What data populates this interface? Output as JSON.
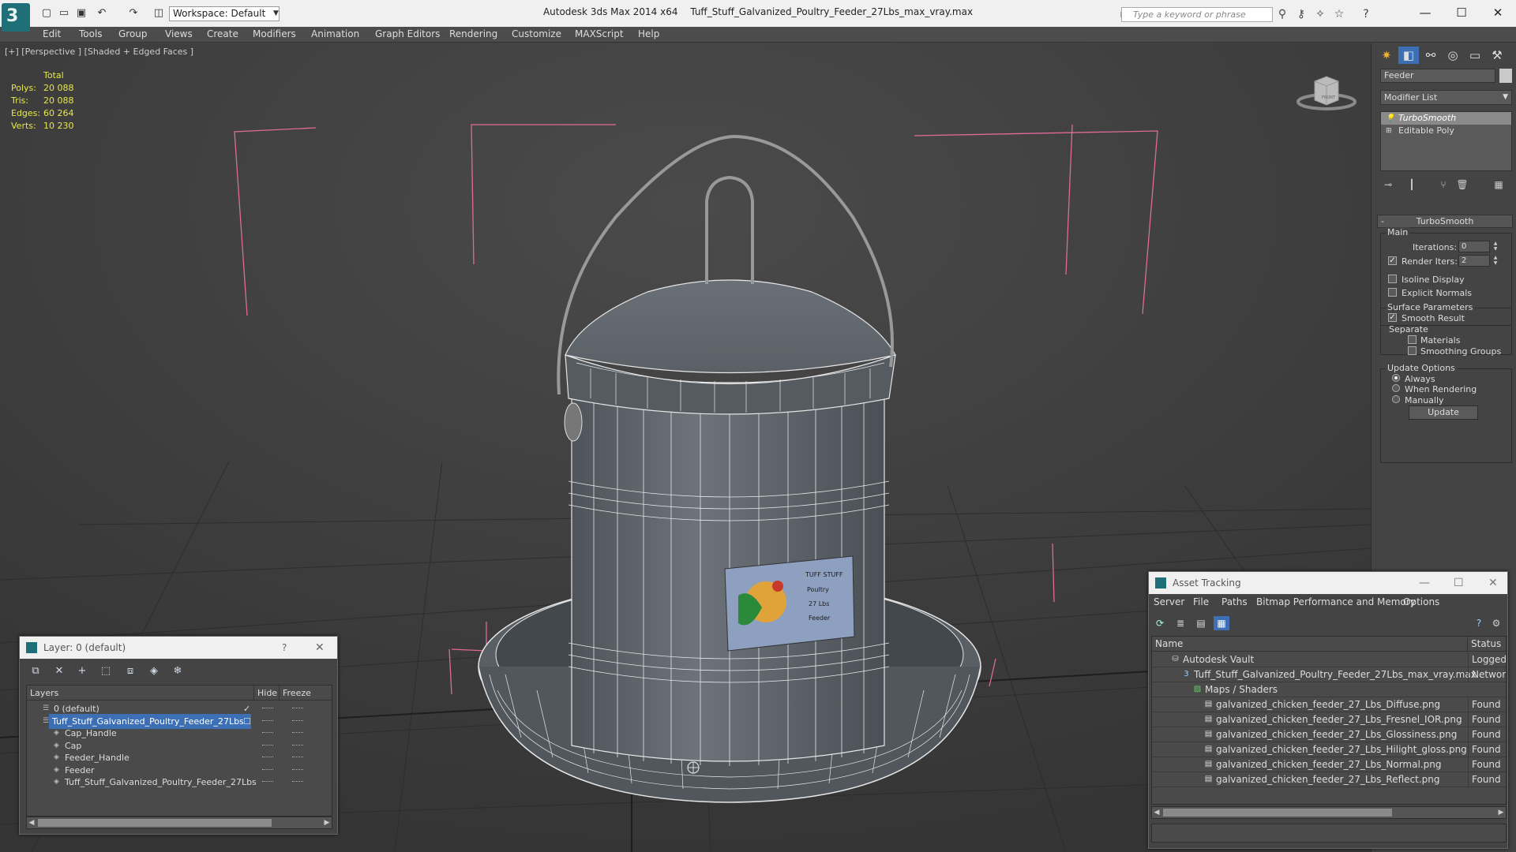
{
  "titlebar": {
    "workspace": "Workspace: Default",
    "app_name": "Autodesk 3ds Max  2014 x64",
    "file_name": "Tuff_Stuff_Galvanized_Poultry_Feeder_27Lbs_max_vray.max",
    "search_placeholder": "Type a keyword or phrase"
  },
  "menu": [
    "Edit",
    "Tools",
    "Group",
    "Views",
    "Create",
    "Modifiers",
    "Animation",
    "Graph Editors",
    "Rendering",
    "Customize",
    "MAXScript",
    "Help"
  ],
  "viewport": {
    "label": "[+] [Perspective ] [Shaded + Edged Faces ]",
    "stats": {
      "header": "Total",
      "rows": [
        {
          "label": "Polys:",
          "value": "20 088"
        },
        {
          "label": "Tris:",
          "value": "20 088"
        },
        {
          "label": "Edges:",
          "value": "60 264"
        },
        {
          "label": "Verts:",
          "value": "10 230"
        }
      ]
    },
    "viewcube_label": "FRONT",
    "feeder_label_text": [
      "TUFF STUFF",
      "Poultry",
      "27 Lbs",
      "Feeder"
    ]
  },
  "command_panel": {
    "object_name": "Feeder",
    "modifier_list": "Modifier List",
    "stack": [
      "TurboSmooth",
      "Editable Poly"
    ],
    "rollout_title": "TurboSmooth",
    "main": {
      "title": "Main",
      "iterations_label": "Iterations:",
      "iterations_value": "0",
      "render_iters_label": "Render Iters:",
      "render_iters_value": "2",
      "isoline_label": "Isoline Display",
      "explicit_label": "Explicit Normals"
    },
    "surface": {
      "title": "Surface Parameters",
      "smooth_label": "Smooth Result",
      "separate_label": "Separate",
      "materials_label": "Materials",
      "smoothing_groups_label": "Smoothing Groups"
    },
    "update": {
      "title": "Update Options",
      "always": "Always",
      "when_rendering": "When Rendering",
      "manually": "Manually",
      "update_button": "Update"
    }
  },
  "layer_dialog": {
    "title": "Layer: 0 (default)",
    "help": "?",
    "headers": {
      "layers": "Layers",
      "hide": "Hide",
      "freeze": "Freeze"
    },
    "rows": [
      {
        "name": "0 (default)",
        "level": 1
      },
      {
        "name": "Tuff_Stuff_Galvanized_Poultry_Feeder_27Lbs",
        "level": 1
      },
      {
        "name": "Cap_Handle",
        "level": 2
      },
      {
        "name": "Cap",
        "level": 2
      },
      {
        "name": "Feeder_Handle",
        "level": 2
      },
      {
        "name": "Feeder",
        "level": 2
      },
      {
        "name": "Tuff_Stuff_Galvanized_Poultry_Feeder_27Lbs",
        "level": 2
      }
    ]
  },
  "asset_dialog": {
    "title": "Asset Tracking",
    "menu": [
      "Server",
      "File",
      "Paths",
      "Bitmap Performance and Memory",
      "Options"
    ],
    "headers": {
      "name": "Name",
      "status": "Status"
    },
    "rows": [
      {
        "name": "Autodesk Vault",
        "status": "Logged O",
        "level": 0
      },
      {
        "name": "Tuff_Stuff_Galvanized_Poultry_Feeder_27Lbs_max_vray.max",
        "status": "Network",
        "level": 1
      },
      {
        "name": "Maps / Shaders",
        "status": "",
        "level": 2
      },
      {
        "name": "galvanized_chicken_feeder_27_Lbs_Diffuse.png",
        "status": "Found",
        "level": 3
      },
      {
        "name": "galvanized_chicken_feeder_27_Lbs_Fresnel_IOR.png",
        "status": "Found",
        "level": 3
      },
      {
        "name": "galvanized_chicken_feeder_27_Lbs_Glossiness.png",
        "status": "Found",
        "level": 3
      },
      {
        "name": "galvanized_chicken_feeder_27_Lbs_Hilight_gloss.png",
        "status": "Found",
        "level": 3
      },
      {
        "name": "galvanized_chicken_feeder_27_Lbs_Normal.png",
        "status": "Found",
        "level": 3
      },
      {
        "name": "galvanized_chicken_feeder_27_Lbs_Reflect.png",
        "status": "Found",
        "level": 3
      }
    ]
  },
  "colors": {
    "selection": "#3d6fb5",
    "stats_text": "#e8e84a",
    "bounding_lines": "#e06a9a"
  }
}
